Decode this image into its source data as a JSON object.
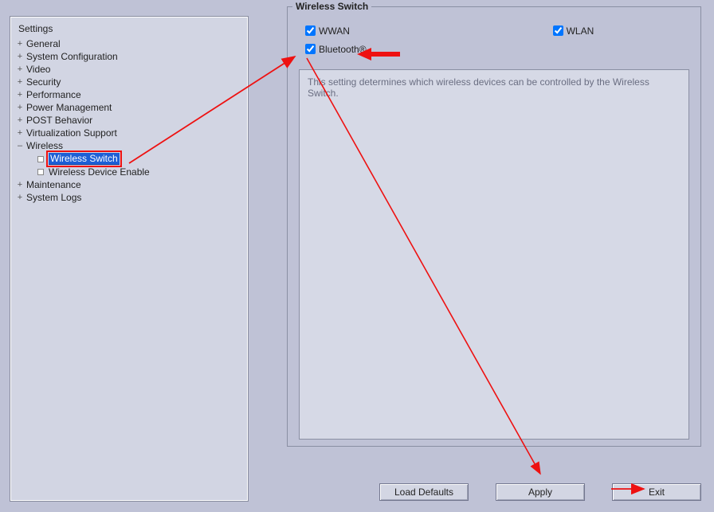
{
  "sidebar": {
    "title": "Settings",
    "items": [
      {
        "label": "General"
      },
      {
        "label": "System Configuration"
      },
      {
        "label": "Video"
      },
      {
        "label": "Security"
      },
      {
        "label": "Performance"
      },
      {
        "label": "Power Management"
      },
      {
        "label": "POST Behavior"
      },
      {
        "label": "Virtualization Support"
      },
      {
        "label": "Wireless"
      },
      {
        "label": "Maintenance"
      },
      {
        "label": "System Logs"
      }
    ],
    "wireless_children": [
      {
        "label": "Wireless Switch",
        "selected": true
      },
      {
        "label": "Wireless Device Enable"
      }
    ]
  },
  "panel": {
    "title": "Wireless Switch",
    "checks": {
      "wwan": "WWAN",
      "wlan": "WLAN",
      "bt": "Bluetooth®"
    },
    "desc": "This setting determines which wireless devices can be controlled by the Wireless Switch."
  },
  "buttons": {
    "load": "Load Defaults",
    "apply": "Apply",
    "exit": "Exit"
  }
}
